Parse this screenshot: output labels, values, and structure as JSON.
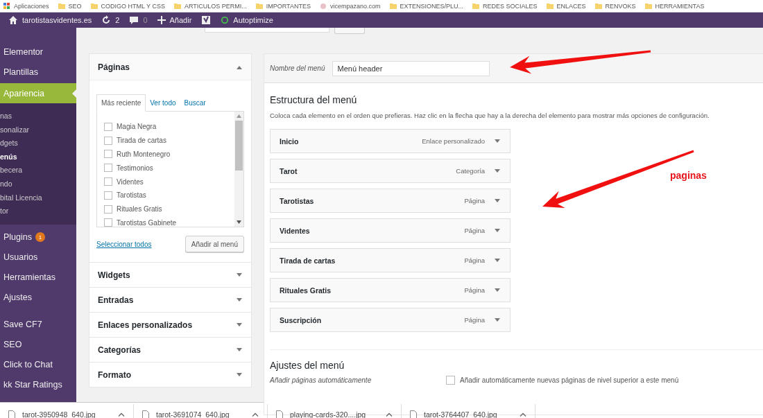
{
  "bookmarks_bar": [
    {
      "label": "Aplicaciones",
      "kind": "apps"
    },
    {
      "label": "SEO",
      "kind": "folder"
    },
    {
      "label": "CODIGO HTML Y CSS",
      "kind": "folder"
    },
    {
      "label": "ARTICULOS PERMI...",
      "kind": "folder"
    },
    {
      "label": "IMPORTANTES",
      "kind": "folder"
    },
    {
      "label": "vicempazano.com",
      "kind": "site"
    },
    {
      "label": "EXTENSIONES/PLU...",
      "kind": "folder"
    },
    {
      "label": "REDES SOCIALES",
      "kind": "folder"
    },
    {
      "label": "ENLACES",
      "kind": "folder"
    },
    {
      "label": "RENVOKS",
      "kind": "folder"
    },
    {
      "label": "HERRAMIENTAS",
      "kind": "folder"
    }
  ],
  "admin_bar": {
    "site": "tarotistasvidentes.es",
    "updates": "2",
    "comments": "0",
    "new": "Añadir",
    "autoptimize": "Autoptimize"
  },
  "sidebar": {
    "groups": [
      [
        {
          "label": "Elementor",
          "selected": false
        },
        {
          "label": "Plantillas",
          "selected": false
        },
        {
          "label": "Apariencia",
          "selected": true,
          "children": [
            {
              "label": "nas",
              "selected": false
            },
            {
              "label": "sonalizar",
              "selected": false
            },
            {
              "label": "dgets",
              "selected": false
            },
            {
              "label": "enús",
              "selected": true
            },
            {
              "label": "becera",
              "selected": false
            },
            {
              "label": "ndo",
              "selected": false
            },
            {
              "label": "bital Licencia",
              "selected": false
            },
            {
              "label": "tor",
              "selected": false
            }
          ]
        },
        {
          "label": "Plugins",
          "selected": false,
          "badge": "1"
        },
        {
          "label": "Usuarios",
          "selected": false
        },
        {
          "label": "Herramientas",
          "selected": false
        },
        {
          "label": "Ajustes",
          "selected": false
        }
      ],
      [
        {
          "label": "Save CF7",
          "selected": false
        },
        {
          "label": "SEO",
          "selected": false
        },
        {
          "label": "Click to Chat",
          "selected": false
        },
        {
          "label": "kk Star Ratings",
          "selected": false
        }
      ]
    ]
  },
  "pages_panel": {
    "title": "Páginas",
    "expanded": true,
    "tabs": [
      {
        "label": "Más reciente",
        "selected": true
      },
      {
        "label": "Ver todo",
        "selected": false
      },
      {
        "label": "Buscar",
        "selected": false
      }
    ],
    "items": [
      {
        "label": "Magia Negra",
        "checked": false
      },
      {
        "label": "Tirada de cartas",
        "checked": false
      },
      {
        "label": "Ruth Montenegro",
        "checked": false
      },
      {
        "label": "Testimonios",
        "checked": false
      },
      {
        "label": "Videntes",
        "checked": false
      },
      {
        "label": "Tarotistas",
        "checked": false
      },
      {
        "label": "Rituales Gratis",
        "checked": false
      },
      {
        "label": "Tarotistas Gabinete",
        "checked": false
      }
    ],
    "select_all": "Seleccionar todos",
    "add_button": "Añadir al menú"
  },
  "accordions": [
    {
      "title": "Widgets",
      "expanded": false
    },
    {
      "title": "Entradas",
      "expanded": false
    },
    {
      "title": "Enlaces personalizados",
      "expanded": false
    },
    {
      "title": "Categorías",
      "expanded": false
    },
    {
      "title": "Formato",
      "expanded": false
    }
  ],
  "menu_editor": {
    "name_label": "Nombre del menú",
    "name_value": "Menú header",
    "structure_title": "Estructura del menú",
    "description": "Coloca cada elemento en el orden que prefieras. Haz clic en la flecha que hay a la derecha del elemento para mostrar más opciones de configuración.",
    "items": [
      {
        "title": "Inicio",
        "type": "Enlace personalizado"
      },
      {
        "title": "Tarot",
        "type": "Categoría"
      },
      {
        "title": "Tarotistas",
        "type": "Página"
      },
      {
        "title": "Videntes",
        "type": "Página"
      },
      {
        "title": "Tirada de cartas",
        "type": "Página"
      },
      {
        "title": "Rituales Gratis",
        "type": "Página"
      },
      {
        "title": "Suscripción",
        "type": "Página"
      }
    ],
    "settings_title": "Ajustes del menú",
    "auto_add_label": "Añadir páginas automáticamente",
    "auto_add": {
      "label": "Añadir automáticamente nuevas páginas de nivel superior a este menú",
      "checked": false
    }
  },
  "annotation": {
    "label": "paginas"
  },
  "downloads": [
    {
      "name": "tarot-3950948_640.jpg"
    },
    {
      "name": "tarot-3691074_640.jpg"
    },
    {
      "name": "playing-cards-320....jpg"
    },
    {
      "name": "tarot-3764407_640.jpg"
    }
  ]
}
